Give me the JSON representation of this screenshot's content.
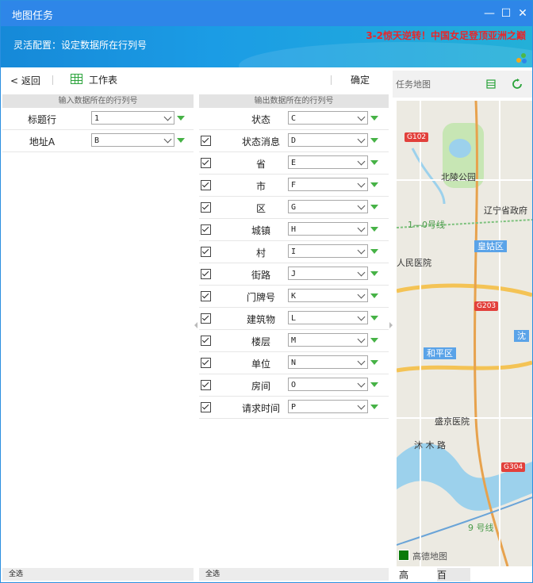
{
  "window": {
    "title": "地图任务"
  },
  "banner": {
    "config_text": "灵活配置：设定数据所在行列号",
    "news": "3-2惊天逆转！中国女足登顶亚洲之巅"
  },
  "toolbar": {
    "back_label": "< 返回",
    "sheet_label": "工作表",
    "confirm_label": "确定"
  },
  "input_panel": {
    "header": "输入数据所在的行列号",
    "rows": [
      {
        "label": "标题行",
        "value": "1"
      },
      {
        "label": "地址A",
        "value": "B"
      }
    ],
    "footer": "全选"
  },
  "output_panel": {
    "header": "输出数据所在的行列号",
    "rows": [
      {
        "label": "状态",
        "value": "C",
        "checked": false
      },
      {
        "label": "状态消息",
        "value": "D",
        "checked": true
      },
      {
        "label": "省",
        "value": "E",
        "checked": true
      },
      {
        "label": "市",
        "value": "F",
        "checked": true
      },
      {
        "label": "区",
        "value": "G",
        "checked": true
      },
      {
        "label": "城镇",
        "value": "H",
        "checked": true
      },
      {
        "label": "村",
        "value": "I",
        "checked": true
      },
      {
        "label": "街路",
        "value": "J",
        "checked": true
      },
      {
        "label": "门牌号",
        "value": "K",
        "checked": true
      },
      {
        "label": "建筑物",
        "value": "L",
        "checked": true
      },
      {
        "label": "楼层",
        "value": "M",
        "checked": true
      },
      {
        "label": "单位",
        "value": "N",
        "checked": true
      },
      {
        "label": "房间",
        "value": "O",
        "checked": true
      },
      {
        "label": "请求时间",
        "value": "P",
        "checked": true
      }
    ],
    "footer": "全选"
  },
  "map_panel": {
    "title": "任务地图",
    "labels": {
      "g102": "G102",
      "beiling_park": "北陵公园",
      "liaoning_gov": "辽宁省政府",
      "line1": "1—0号线",
      "huanggu": "皇姑区",
      "hospital1": "人民医院",
      "g203": "G203",
      "shen": "沈",
      "heping": "和平区",
      "shengjing": "盛京医院",
      "road": "沐 木 路",
      "g304": "G304",
      "line9": "9 号线",
      "gaode": "高德地图"
    },
    "footer": {
      "left": "高",
      "right": "百"
    }
  },
  "colors": {
    "accent": "#2e86e8",
    "banner_news": "#e8262a",
    "dropdown_arrow": "#46b246",
    "sheet_icon": "#2aa33a"
  }
}
